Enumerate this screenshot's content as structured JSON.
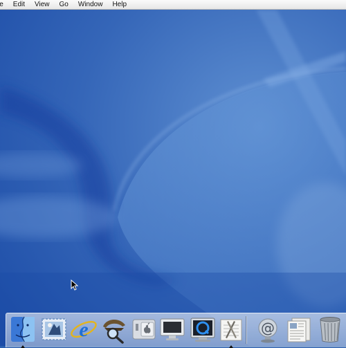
{
  "menu_bar": {
    "items": [
      {
        "label": "le"
      },
      {
        "label": "Edit"
      },
      {
        "label": "View"
      },
      {
        "label": "Go"
      },
      {
        "label": "Window"
      },
      {
        "label": "Help"
      }
    ]
  },
  "desktop": {
    "wallpaper": "aqua-blue",
    "colors": {
      "base": "#2a5fb0",
      "light": "#6b9ad6",
      "dark": "#14389a"
    }
  },
  "dock": {
    "apps": [
      {
        "name": "Finder",
        "icon": "finder-icon",
        "running": true
      },
      {
        "name": "Mail",
        "icon": "mail-icon",
        "running": false
      },
      {
        "name": "Internet Explorer",
        "icon": "internet-explorer-icon",
        "running": false
      },
      {
        "name": "Sherlock",
        "icon": "sherlock-icon",
        "running": false
      },
      {
        "name": "System Preferences",
        "icon": "system-preferences-icon",
        "running": false
      },
      {
        "name": "Monitor",
        "icon": "monitor-icon",
        "running": false
      },
      {
        "name": "QuickTime Player",
        "icon": "quicktime-icon",
        "running": false
      },
      {
        "name": "TextEdit",
        "icon": "textedit-icon",
        "running": true
      }
    ],
    "docs": [
      {
        "name": "Email",
        "icon": "email-globe-icon"
      },
      {
        "name": "Documents",
        "icon": "documents-icon"
      },
      {
        "name": "Trash",
        "icon": "trash-icon"
      }
    ]
  }
}
